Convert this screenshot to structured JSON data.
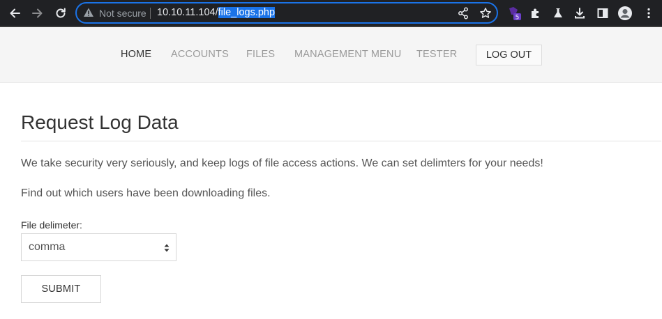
{
  "browser": {
    "security_label": "Not secure",
    "url_host": "10.10.11.104/",
    "url_path": "file_logs.php",
    "extension_badge": "5",
    "icons": [
      "back-icon",
      "forward-icon",
      "reload-icon",
      "warning-icon",
      "share-icon",
      "star-icon",
      "extension-icon",
      "puzzle-icon",
      "lab-flask-icon",
      "download-icon",
      "side-panel-icon",
      "profile-icon",
      "kebab-menu-icon"
    ],
    "accent_color": "#1a73e8"
  },
  "nav": {
    "items": [
      {
        "label": "HOME",
        "active": true
      },
      {
        "label": "ACCOUNTS",
        "active": false
      },
      {
        "label": "FILES",
        "active": false
      },
      {
        "label": "MANAGEMENT MENU",
        "active": false
      },
      {
        "label": "TESTER",
        "active": false
      }
    ],
    "logout_label": "LOG OUT"
  },
  "main": {
    "title": "Request Log Data",
    "intro": "We take security very seriously, and keep logs of file access actions. We can set delimters for your needs!",
    "subintro": "Find out which users have been downloading files.",
    "delimiter_label": "File delimeter:",
    "delimiter_value": "comma",
    "submit_label": "SUBMIT"
  }
}
